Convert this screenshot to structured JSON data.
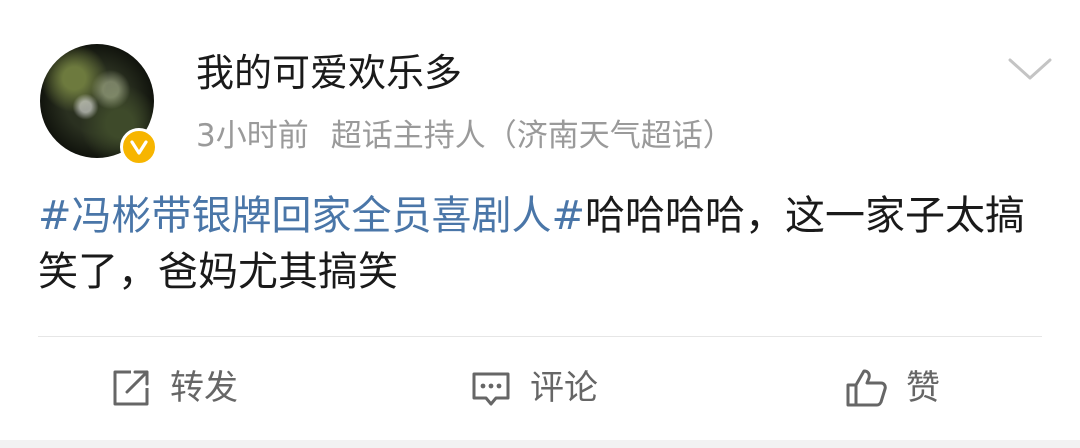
{
  "post": {
    "author": "我的可爱欢乐多",
    "time": "3小时前",
    "source": "超话主持人（济南天气超话）",
    "topic": "#冯彬带银牌回家全员喜剧人#",
    "text": "哈哈哈哈，这一家子太搞笑了，爸妈尤其搞笑"
  },
  "actions": {
    "repost_label": "转发",
    "comment_label": "评论",
    "like_label": "赞"
  },
  "icons": {
    "badge": "verified-v-icon",
    "menu": "chevron-down-icon",
    "repost": "repost-icon",
    "comment": "comment-icon",
    "like": "thumbs-up-icon"
  },
  "colors": {
    "topic": "#4a76a8",
    "badge": "#f7b500",
    "name": "#1a1a1a",
    "meta": "#9a9a9a",
    "action": "#666666"
  }
}
